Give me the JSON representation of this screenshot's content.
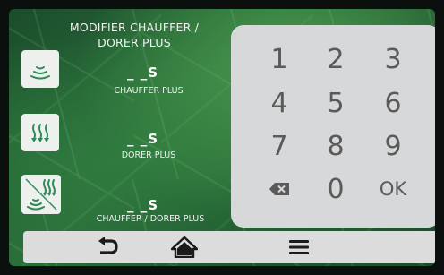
{
  "title": {
    "line1": "MODIFIER CHAUFFER /",
    "line2": "DORER PLUS"
  },
  "settings": [
    {
      "icon": "heat-waves-icon",
      "value": "_ _S",
      "label": "CHAUFFER PLUS"
    },
    {
      "icon": "browning-coils-icon",
      "value": "_ _S",
      "label": "DORER PLUS"
    },
    {
      "icon": "heat-and-brown-icon",
      "value": "_ _S",
      "label": "CHAUFFER / DORER PLUS"
    }
  ],
  "keypad": {
    "k1": "1",
    "k2": "2",
    "k3": "3",
    "k4": "4",
    "k5": "5",
    "k6": "6",
    "k7": "7",
    "k8": "8",
    "k9": "9",
    "k0": "0",
    "ok": "OK",
    "backspace_icon": "backspace-icon"
  },
  "nav": {
    "back_icon": "back-arrow-icon",
    "home_icon": "home-icon",
    "menu_icon": "menu-icon"
  },
  "colors": {
    "background": "#2a6d3a",
    "panel": "#d7d8d9",
    "icon_stroke": "#2e8b57",
    "nav_icon": "#1a1a1a"
  }
}
